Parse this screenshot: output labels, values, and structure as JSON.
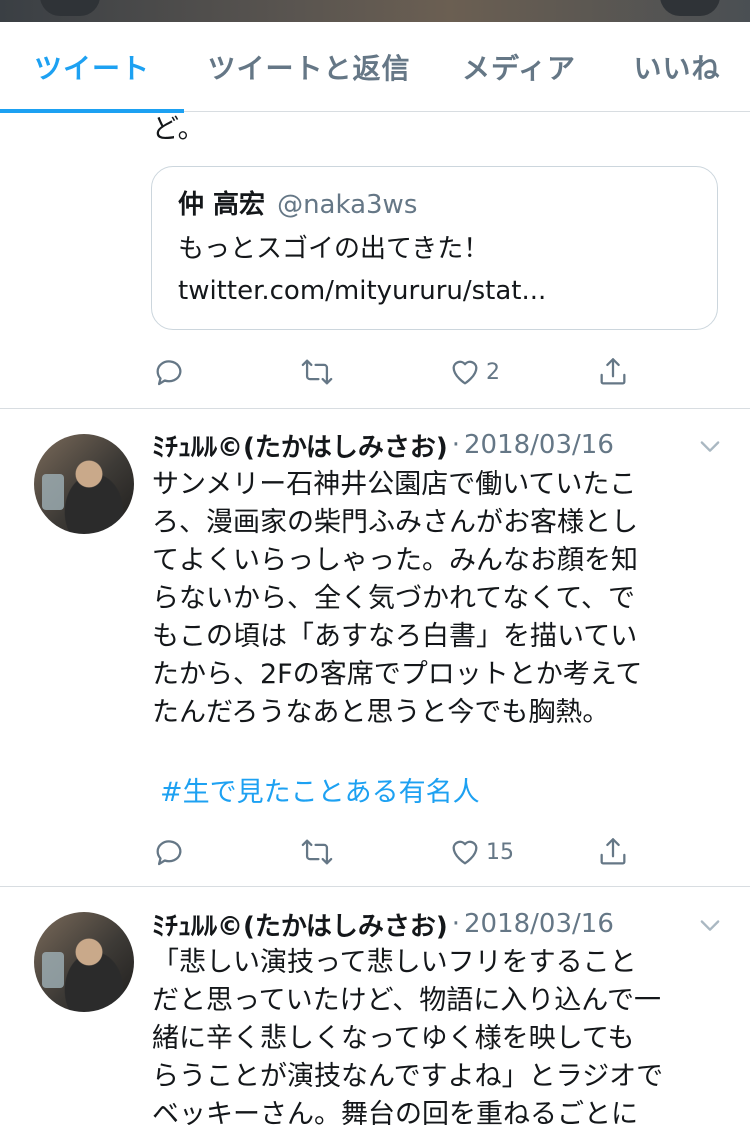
{
  "tabs": [
    {
      "label": "ツイート",
      "active": true
    },
    {
      "label": "ツイートと返信",
      "active": false
    },
    {
      "label": "メディア",
      "active": false
    },
    {
      "label": "いいね",
      "active": false
    }
  ],
  "tweet0": {
    "continuation": "ど。",
    "quote": {
      "name": "仲 高宏",
      "handle": "@naka3ws",
      "text": "もっとスゴイの出てきた！",
      "link": "twitter.com/mityururu/stat..."
    },
    "actions": {
      "likes": "2"
    }
  },
  "tweet1": {
    "name": "ﾐﾁｭﾙﾙ©(たかはしみさお)",
    "separator": "·",
    "date": "2018/03/16",
    "lines": [
      "サンメリー石神井公園店で働いていたこ",
      "ろ、漫画家の柴門ふみさんがお客様とし",
      "てよくいらっしゃった。みんなお顔を知",
      "らないから、全く気づかれてなくて、で",
      "もこの頃は「あすなろ白書」を描いてい",
      "たから、2Fの客席でプロットとか考えて",
      "たんだろうなあと思うと今でも胸熱。"
    ],
    "hashtag": "#生で見たことある有名人",
    "actions": {
      "likes": "15"
    }
  },
  "tweet2": {
    "name": "ﾐﾁｭﾙﾙ©(たかはしみさお)",
    "separator": "·",
    "date": "2018/03/16",
    "lines": [
      "「悲しい演技って悲しいフリをすること",
      "だと思っていたけど、物語に入り込んで一",
      "緒に辛く悲しくなってゆく様を映しても",
      "らうことが演技なんですよね」とラジオで",
      "ベッキーさん。舞台の回を重ねるごとに"
    ]
  },
  "colors": {
    "accent": "#1da1f2",
    "muted": "#657786",
    "text": "#14171a",
    "divider": "#d8dde1"
  },
  "icons": [
    "reply-icon",
    "retweet-icon",
    "like-icon",
    "share-icon",
    "chevron-down-icon"
  ]
}
